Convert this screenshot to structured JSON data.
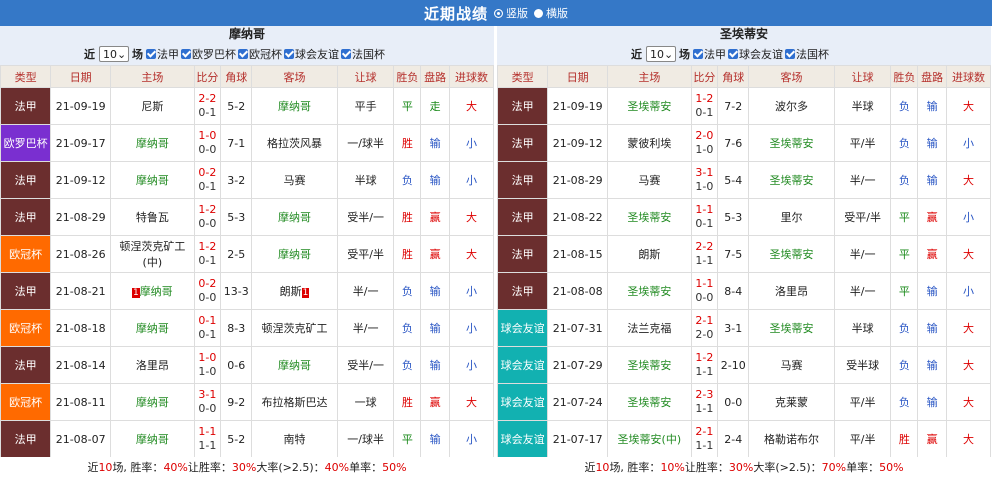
{
  "header": {
    "title": "近期战绩",
    "options": [
      "竖版",
      "横版"
    ]
  },
  "left": {
    "team": "摩纳哥",
    "filter": {
      "prefix": "近",
      "count": "10",
      "suffix": "场",
      "comps": [
        "法甲",
        "欧罗巴杯",
        "欧冠杯",
        "球会友谊",
        "法国杯"
      ]
    },
    "columns": [
      "类型",
      "日期",
      "主场",
      "比分",
      "角球",
      "客场",
      "让球",
      "胜负",
      "盘路",
      "进球数"
    ],
    "rows": [
      {
        "type": "法甲",
        "tc": "t-fa",
        "date": "21-09-19",
        "home": "尼斯",
        "hg": false,
        "ft": "2-2",
        "ht": "0-1",
        "corner": "5-2",
        "away": "摩纳哥",
        "ag": true,
        "hcp": "平手",
        "wl": "平",
        "wlc": "grn",
        "pan": "走",
        "panc": "grn",
        "goal": "大",
        "goalc": "red"
      },
      {
        "type": "欧罗巴杯",
        "tc": "t-eu",
        "date": "21-09-17",
        "home": "摩纳哥",
        "hg": true,
        "ft": "1-0",
        "ht": "0-0",
        "corner": "7-1",
        "away": "格拉茨风暴",
        "ag": false,
        "hcp": "一/球半",
        "wl": "胜",
        "wlc": "red",
        "pan": "输",
        "panc": "blue",
        "goal": "小",
        "goalc": "blue"
      },
      {
        "type": "法甲",
        "tc": "t-fa",
        "date": "21-09-12",
        "home": "摩纳哥",
        "hg": true,
        "ft": "0-2",
        "ht": "0-1",
        "corner": "3-2",
        "away": "马赛",
        "ag": false,
        "hcp": "半球",
        "wl": "负",
        "wlc": "blue",
        "pan": "输",
        "panc": "blue",
        "goal": "小",
        "goalc": "blue"
      },
      {
        "type": "法甲",
        "tc": "t-fa",
        "date": "21-08-29",
        "home": "特鲁瓦",
        "hg": false,
        "ft": "1-2",
        "ht": "0-0",
        "corner": "5-3",
        "away": "摩纳哥",
        "ag": true,
        "hcp": "受半/一",
        "wl": "胜",
        "wlc": "red",
        "pan": "赢",
        "panc": "red",
        "goal": "大",
        "goalc": "red"
      },
      {
        "type": "欧冠杯",
        "tc": "t-ou",
        "date": "21-08-26",
        "home": "顿涅茨克矿工(中)",
        "hg": false,
        "ft": "1-2",
        "ht": "0-1",
        "corner": "2-5",
        "away": "摩纳哥",
        "ag": true,
        "hcp": "受平/半",
        "wl": "胜",
        "wlc": "red",
        "pan": "赢",
        "panc": "red",
        "goal": "大",
        "goalc": "red"
      },
      {
        "type": "法甲",
        "tc": "t-fa",
        "date": "21-08-21",
        "home": "摩纳哥",
        "hg": true,
        "hrc": "1",
        "ft": "0-2",
        "ht": "0-0",
        "corner": "13-3",
        "away": "朗斯",
        "ag": false,
        "arc": "1",
        "hcp": "半/一",
        "wl": "负",
        "wlc": "blue",
        "pan": "输",
        "panc": "blue",
        "goal": "小",
        "goalc": "blue"
      },
      {
        "type": "欧冠杯",
        "tc": "t-ou",
        "date": "21-08-18",
        "home": "摩纳哥",
        "hg": true,
        "ft": "0-1",
        "ht": "0-1",
        "corner": "8-3",
        "away": "顿涅茨克矿工",
        "ag": false,
        "hcp": "半/一",
        "wl": "负",
        "wlc": "blue",
        "pan": "输",
        "panc": "blue",
        "goal": "小",
        "goalc": "blue"
      },
      {
        "type": "法甲",
        "tc": "t-fa",
        "date": "21-08-14",
        "home": "洛里昂",
        "hg": false,
        "ft": "1-0",
        "ht": "1-0",
        "corner": "0-6",
        "away": "摩纳哥",
        "ag": true,
        "hcp": "受半/一",
        "wl": "负",
        "wlc": "blue",
        "pan": "输",
        "panc": "blue",
        "goal": "小",
        "goalc": "blue"
      },
      {
        "type": "欧冠杯",
        "tc": "t-ou",
        "date": "21-08-11",
        "home": "摩纳哥",
        "hg": true,
        "ft": "3-1",
        "ht": "0-0",
        "corner": "9-2",
        "away": "布拉格斯巴达",
        "ag": false,
        "hcp": "一球",
        "wl": "胜",
        "wlc": "red",
        "pan": "赢",
        "panc": "red",
        "goal": "大",
        "goalc": "red"
      },
      {
        "type": "法甲",
        "tc": "t-fa",
        "date": "21-08-07",
        "home": "摩纳哥",
        "hg": true,
        "ft": "1-1",
        "ht": "1-1",
        "corner": "5-2",
        "away": "南特",
        "ag": false,
        "hcp": "一/球半",
        "wl": "平",
        "wlc": "grn",
        "pan": "输",
        "panc": "blue",
        "goal": "小",
        "goalc": "blue"
      }
    ],
    "summary": {
      "a": "近",
      "n": "10",
      "b": "场, 胜率：",
      "win": "40%",
      "c": "让胜率：",
      "hwin": "30%",
      "d": "大率(>2.5)：",
      "big": "40%",
      "e": "单率：",
      "odd": "50%"
    }
  },
  "right": {
    "team": "圣埃蒂安",
    "filter": {
      "prefix": "近",
      "count": "10",
      "suffix": "场",
      "comps": [
        "法甲",
        "球会友谊",
        "法国杯"
      ]
    },
    "columns": [
      "类型",
      "日期",
      "主场",
      "比分",
      "角球",
      "客场",
      "让球",
      "胜负",
      "盘路",
      "进球数"
    ],
    "rows": [
      {
        "type": "法甲",
        "tc": "t-fa",
        "date": "21-09-19",
        "home": "圣埃蒂安",
        "hg": true,
        "ft": "1-2",
        "ht": "0-1",
        "corner": "7-2",
        "away": "波尔多",
        "ag": false,
        "hcp": "半球",
        "wl": "负",
        "wlc": "blue",
        "pan": "输",
        "panc": "blue",
        "goal": "大",
        "goalc": "red"
      },
      {
        "type": "法甲",
        "tc": "t-fa",
        "date": "21-09-12",
        "home": "蒙彼利埃",
        "hg": false,
        "ft": "2-0",
        "ht": "1-0",
        "corner": "7-6",
        "away": "圣埃蒂安",
        "ag": true,
        "hcp": "平/半",
        "wl": "负",
        "wlc": "blue",
        "pan": "输",
        "panc": "blue",
        "goal": "小",
        "goalc": "blue"
      },
      {
        "type": "法甲",
        "tc": "t-fa",
        "date": "21-08-29",
        "home": "马赛",
        "hg": false,
        "ft": "3-1",
        "ht": "1-0",
        "corner": "5-4",
        "away": "圣埃蒂安",
        "ag": true,
        "hcp": "半/一",
        "wl": "负",
        "wlc": "blue",
        "pan": "输",
        "panc": "blue",
        "goal": "大",
        "goalc": "red"
      },
      {
        "type": "法甲",
        "tc": "t-fa",
        "date": "21-08-22",
        "home": "圣埃蒂安",
        "hg": true,
        "ft": "1-1",
        "ht": "0-1",
        "corner": "5-3",
        "away": "里尔",
        "ag": false,
        "hcp": "受平/半",
        "wl": "平",
        "wlc": "grn",
        "pan": "赢",
        "panc": "red",
        "goal": "小",
        "goalc": "blue"
      },
      {
        "type": "法甲",
        "tc": "t-fa",
        "date": "21-08-15",
        "home": "朗斯",
        "hg": false,
        "ft": "2-2",
        "ht": "1-1",
        "corner": "7-5",
        "away": "圣埃蒂安",
        "ag": true,
        "hcp": "半/一",
        "wl": "平",
        "wlc": "grn",
        "pan": "赢",
        "panc": "red",
        "goal": "大",
        "goalc": "red"
      },
      {
        "type": "法甲",
        "tc": "t-fa",
        "date": "21-08-08",
        "home": "圣埃蒂安",
        "hg": true,
        "ft": "1-1",
        "ht": "0-0",
        "corner": "8-4",
        "away": "洛里昂",
        "ag": false,
        "hcp": "半/一",
        "wl": "平",
        "wlc": "grn",
        "pan": "输",
        "panc": "blue",
        "goal": "小",
        "goalc": "blue"
      },
      {
        "type": "球会友谊",
        "tc": "t-qy",
        "date": "21-07-31",
        "home": "法兰克福",
        "hg": false,
        "ft": "2-1",
        "ht": "2-0",
        "corner": "3-1",
        "away": "圣埃蒂安",
        "ag": true,
        "hcp": "半球",
        "wl": "负",
        "wlc": "blue",
        "pan": "输",
        "panc": "blue",
        "goal": "大",
        "goalc": "red"
      },
      {
        "type": "球会友谊",
        "tc": "t-qy",
        "date": "21-07-29",
        "home": "圣埃蒂安",
        "hg": true,
        "ft": "1-2",
        "ht": "1-1",
        "corner": "2-10",
        "away": "马赛",
        "ag": false,
        "hcp": "受半球",
        "wl": "负",
        "wlc": "blue",
        "pan": "输",
        "panc": "blue",
        "goal": "大",
        "goalc": "red"
      },
      {
        "type": "球会友谊",
        "tc": "t-qy",
        "date": "21-07-24",
        "home": "圣埃蒂安",
        "hg": true,
        "ft": "2-3",
        "ht": "1-1",
        "corner": "0-0",
        "away": "克莱蒙",
        "ag": false,
        "hcp": "平/半",
        "wl": "负",
        "wlc": "blue",
        "pan": "输",
        "panc": "blue",
        "goal": "大",
        "goalc": "red"
      },
      {
        "type": "球会友谊",
        "tc": "t-qy",
        "date": "21-07-17",
        "home": "圣埃蒂安(中)",
        "hg": true,
        "ft": "2-1",
        "ht": "1-1",
        "corner": "2-4",
        "away": "格勒诺布尔",
        "ag": false,
        "hcp": "平/半",
        "wl": "胜",
        "wlc": "red",
        "pan": "赢",
        "panc": "red",
        "goal": "大",
        "goalc": "red"
      }
    ],
    "summary": {
      "a": "近",
      "n": "10",
      "b": "场, 胜率：",
      "win": "10%",
      "c": "让胜率：",
      "hwin": "30%",
      "d": "大率(>2.5)：",
      "big": "70%",
      "e": "单率：",
      "odd": "50%"
    }
  }
}
